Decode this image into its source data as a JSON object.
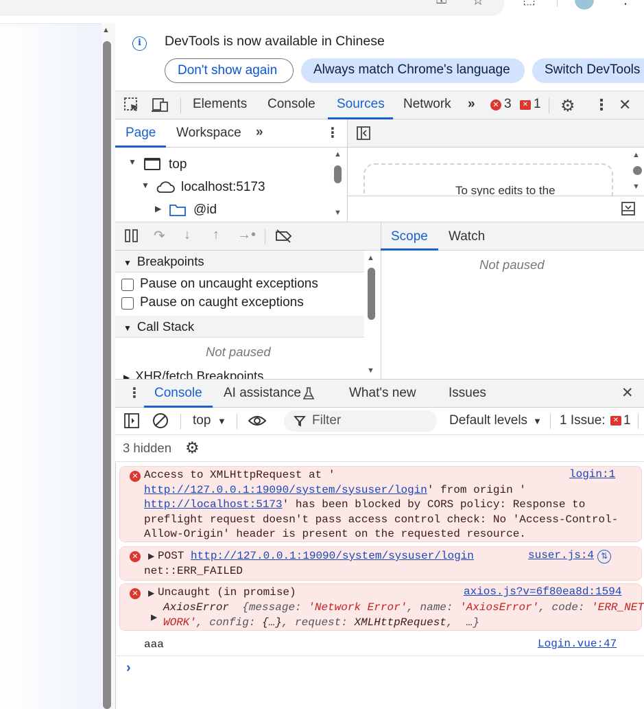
{
  "infobar": {
    "message": "DevTools is now available in Chinese",
    "dont_show": "Don't show again",
    "always_match": "Always match Chrome's language",
    "switch": "Switch DevTools t"
  },
  "main_tabs": {
    "elements": "Elements",
    "console": "Console",
    "sources": "Sources",
    "network": "Network",
    "error_count": "3",
    "issue_count": "1"
  },
  "sources": {
    "page_tab": "Page",
    "workspace_tab": "Workspace",
    "tree": {
      "top": "top",
      "host": "localhost:5173",
      "folder": "@id"
    },
    "sync_text": "To sync edits to the"
  },
  "debugger": {
    "breakpoints_title": "Breakpoints",
    "pause_uncaught": "Pause on uncaught exceptions",
    "pause_caught": "Pause on caught exceptions",
    "call_stack_title": "Call Stack",
    "not_paused": "Not paused",
    "xhr_title": "XHR/fetch Breakpoints",
    "scope_tab": "Scope",
    "watch_tab": "Watch",
    "scope_not_paused": "Not paused"
  },
  "drawer": {
    "console_tab": "Console",
    "ai_tab": "AI assistance",
    "whats_new_tab": "What's new",
    "issues_tab": "Issues"
  },
  "console_toolbar": {
    "context": "top",
    "filter_placeholder": "Filter",
    "levels": "Default levels",
    "issues_label": "1 Issue:",
    "issues_count": "1",
    "hidden": "3 hidden"
  },
  "messages": {
    "m1": {
      "l1": "Access to XMLHttpRequest at '",
      "url1": "http://127.0.0.1:19090/system/sysuser/login",
      "l2b": "' from origin '",
      "url2": "http://localhost:5173",
      "l3b": "' has been blocked by CORS policy: Response to",
      "l4": "preflight request doesn't pass access control check: No 'Access-Control-",
      "l5": "Allow-Origin' header is present on the requested resource.",
      "source": "login:1"
    },
    "m2": {
      "method": "POST ",
      "url": "http://127.0.0.1:19090/system/sysuser/login",
      "l2": "net::ERR_FAILED",
      "source": "suser.js:4"
    },
    "m3": {
      "l1": "Uncaught (in promise)",
      "source": "axios.js?v=6f80ea8d:1594",
      "cls": "AxiosError",
      "k_message": "message",
      "v_message": "'Network Error'",
      "k_name": "name",
      "v_name": "'AxiosError'",
      "k_code": "code",
      "v_code1": "'ERR_NET",
      "v_code2": "WORK'",
      "k_config": "config",
      "v_config": "{…}",
      "k_request": "request",
      "v_request": "XMLHttpRequest",
      "ellipsis": "…"
    },
    "m4": {
      "text": "aaa",
      "source": "Login.vue:47"
    }
  },
  "colors": {
    "accent": "#1a5fd0",
    "error_bg": "#fce8e6",
    "error_icon": "#dc362e"
  }
}
